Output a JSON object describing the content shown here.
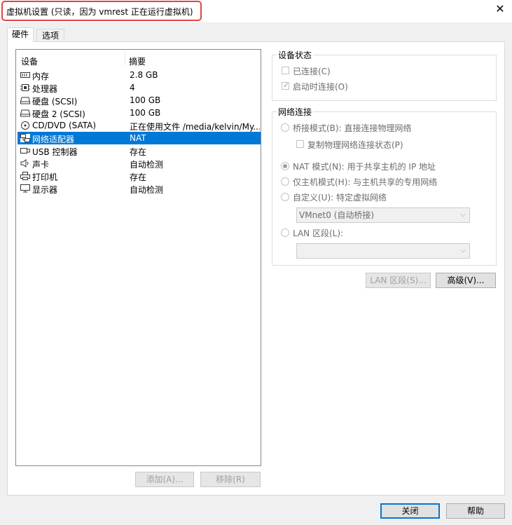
{
  "window": {
    "title": "虚拟机设置 (只读，因为 vmrest 正在运行虚拟机)",
    "close_glyph": "✕"
  },
  "tabs": [
    {
      "label": "硬件",
      "active": true
    },
    {
      "label": "选项",
      "active": false
    }
  ],
  "device_list": {
    "col_device": "设备",
    "col_summary": "摘要",
    "rows": [
      {
        "icon": "memory-icon",
        "device": "内存",
        "summary": "2.8 GB"
      },
      {
        "icon": "processor-icon",
        "device": "处理器",
        "summary": "4"
      },
      {
        "icon": "hard-disk-icon",
        "device": "硬盘 (SCSI)",
        "summary": "100 GB"
      },
      {
        "icon": "hard-disk-icon",
        "device": "硬盘 2 (SCSI)",
        "summary": "100 GB"
      },
      {
        "icon": "cd-dvd-icon",
        "device": "CD/DVD (SATA)",
        "summary": "正在使用文件 /media/kelvin/My..."
      },
      {
        "icon": "network-adapter-icon",
        "device": "网络适配器",
        "summary": "NAT",
        "selected": true
      },
      {
        "icon": "usb-icon",
        "device": "USB 控制器",
        "summary": "存在"
      },
      {
        "icon": "sound-icon",
        "device": "声卡",
        "summary": "自动检测"
      },
      {
        "icon": "printer-icon",
        "device": "打印机",
        "summary": "存在"
      },
      {
        "icon": "display-icon",
        "device": "显示器",
        "summary": "自动检测"
      }
    ]
  },
  "list_buttons": {
    "add": "添加(A)...",
    "remove": "移除(R)"
  },
  "device_status": {
    "title": "设备状态",
    "connected": {
      "label": "已连接(C)",
      "checked": false
    },
    "connect_at_power_on": {
      "label": "启动时连接(O)",
      "checked": true
    }
  },
  "network": {
    "title": "网络连接",
    "bridged": {
      "label": "桥接模式(B): 直接连接物理网络",
      "selected": false
    },
    "replicate": {
      "label": "复制物理网络连接状态(P)",
      "checked": false
    },
    "nat": {
      "label": "NAT 模式(N): 用于共享主机的 IP 地址",
      "selected": true
    },
    "host_only": {
      "label": "仅主机模式(H): 与主机共享的专用网络",
      "selected": false
    },
    "custom": {
      "label": "自定义(U): 特定虚拟网络",
      "selected": false
    },
    "custom_value": "VMnet0 (自动桥接)",
    "lan_segment": {
      "label": "LAN 区段(L):",
      "selected": false
    },
    "lan_value": ""
  },
  "network_buttons": {
    "lan_segments": "LAN 区段(S)...",
    "advanced": "高级(V)..."
  },
  "footer": {
    "close": "关闭",
    "help": "帮助"
  }
}
